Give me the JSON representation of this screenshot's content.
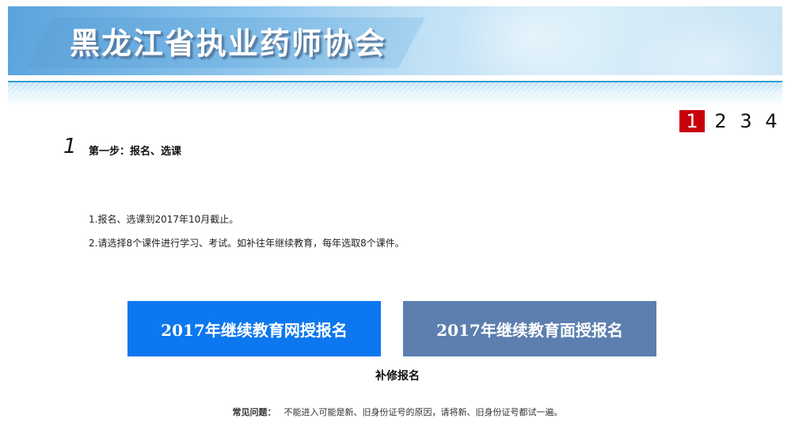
{
  "header": {
    "site_title": "黑龙江省执业药师协会"
  },
  "steps": {
    "items": [
      "1",
      "2",
      "3",
      "4"
    ],
    "active_index": 0,
    "active_color": "#c8000b"
  },
  "current_step": {
    "number": "1",
    "title": "第一步：报名、选课"
  },
  "notes": [
    "1.报名、选课到2017年10月截止。",
    "2.请选择8个课件进行学习、考试。如补往年继续教育，每年选取8个课件。"
  ],
  "buttons": {
    "online_label": "2017年继续教育网授报名",
    "online_color": "#0c77ee",
    "facetoface_label": "2017年继续教育面授报名",
    "facetoface_color": "#5c7fb0",
    "makeup_label": "补修报名"
  },
  "faq": {
    "label": "常见问题：",
    "text": "不能进入可能是新、旧身份证号的原因，请将新、旧身份证号都试一遍。"
  }
}
